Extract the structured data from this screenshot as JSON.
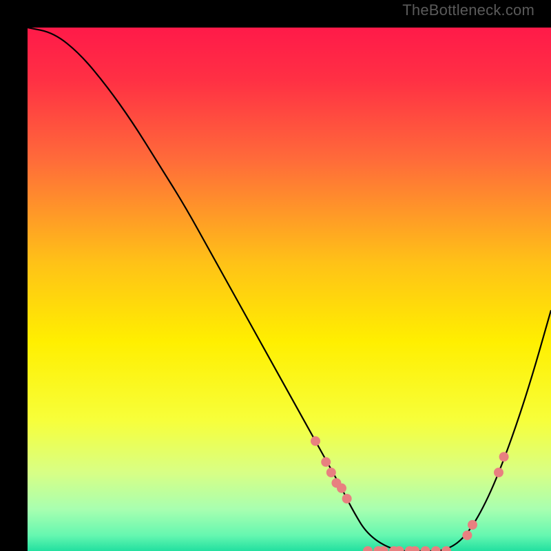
{
  "watermark": "TheBottleneck.com",
  "chart_data": {
    "type": "line",
    "title": "",
    "xlabel": "",
    "ylabel": "",
    "xlim": [
      0,
      100
    ],
    "ylim": [
      0,
      100
    ],
    "grid": false,
    "background_gradient": {
      "stops": [
        {
          "pos": 0.0,
          "color": "#ff1a49"
        },
        {
          "pos": 0.1,
          "color": "#ff3044"
        },
        {
          "pos": 0.25,
          "color": "#ff6a3a"
        },
        {
          "pos": 0.45,
          "color": "#ffc217"
        },
        {
          "pos": 0.6,
          "color": "#ffef00"
        },
        {
          "pos": 0.75,
          "color": "#f7ff3a"
        },
        {
          "pos": 0.85,
          "color": "#d8ff85"
        },
        {
          "pos": 0.92,
          "color": "#a8ffb0"
        },
        {
          "pos": 0.97,
          "color": "#66f7b0"
        },
        {
          "pos": 1.0,
          "color": "#22e0a0"
        }
      ]
    },
    "series": [
      {
        "name": "bottleneck-curve",
        "color": "#000000",
        "x": [
          0,
          5,
          10,
          15,
          20,
          25,
          30,
          35,
          40,
          45,
          50,
          55,
          60,
          62,
          65,
          70,
          75,
          80,
          84,
          88,
          92,
          96,
          100
        ],
        "y": [
          100,
          99,
          95,
          89,
          82,
          74,
          66,
          57,
          48,
          39,
          30,
          21,
          12,
          8,
          3,
          0,
          0,
          0,
          3,
          10,
          20,
          32,
          46
        ]
      }
    ],
    "markers": {
      "name": "highlight-dots",
      "color": "#e88080",
      "radius": 7,
      "points": [
        {
          "x": 55,
          "y": 21
        },
        {
          "x": 57,
          "y": 17
        },
        {
          "x": 58,
          "y": 15
        },
        {
          "x": 59,
          "y": 13
        },
        {
          "x": 60,
          "y": 12
        },
        {
          "x": 61,
          "y": 10
        },
        {
          "x": 65,
          "y": 0
        },
        {
          "x": 67,
          "y": 0
        },
        {
          "x": 68,
          "y": 0
        },
        {
          "x": 70,
          "y": 0
        },
        {
          "x": 71,
          "y": 0
        },
        {
          "x": 73,
          "y": 0
        },
        {
          "x": 74,
          "y": 0
        },
        {
          "x": 76,
          "y": 0
        },
        {
          "x": 78,
          "y": 0
        },
        {
          "x": 80,
          "y": 0
        },
        {
          "x": 84,
          "y": 3
        },
        {
          "x": 85,
          "y": 5
        },
        {
          "x": 90,
          "y": 15
        },
        {
          "x": 91,
          "y": 18
        }
      ]
    }
  }
}
